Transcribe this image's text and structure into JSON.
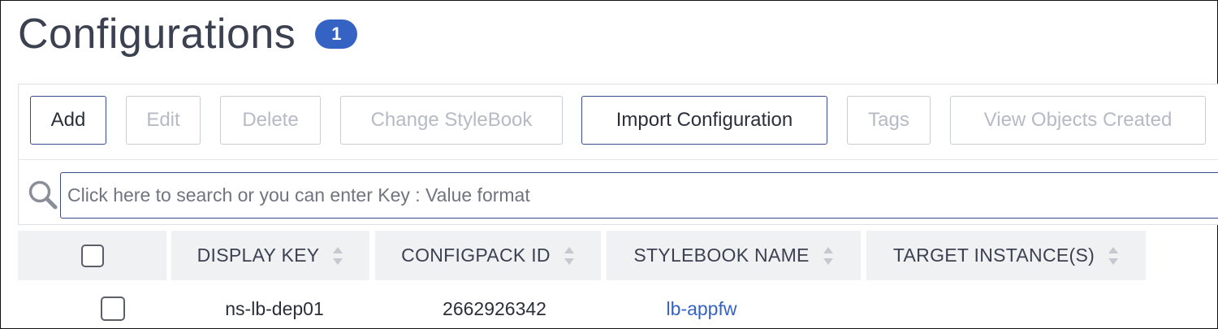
{
  "header": {
    "title": "Configurations",
    "count": "1"
  },
  "toolbar": {
    "buttons": [
      {
        "label": "Add",
        "enabled": true
      },
      {
        "label": "Edit",
        "enabled": false
      },
      {
        "label": "Delete",
        "enabled": false
      },
      {
        "label": "Change StyleBook",
        "enabled": false
      },
      {
        "label": "Import Configuration",
        "enabled": true
      },
      {
        "label": "Tags",
        "enabled": false
      },
      {
        "label": "View Objects Created",
        "enabled": false
      }
    ]
  },
  "search": {
    "placeholder": "Click here to search or you can enter Key : Value format",
    "value": ""
  },
  "table": {
    "columns": [
      "DISPLAY KEY",
      "CONFIGPACK ID",
      "STYLEBOOK NAME",
      "TARGET INSTANCE(S)"
    ],
    "rows": [
      {
        "display_key": "ns-lb-dep01",
        "configpack_id": "2662926342",
        "stylebook_name": "lb-appfw",
        "target_instances": ""
      }
    ]
  },
  "colors": {
    "accent": "#3563c4",
    "active_border": "#3a4a8a",
    "disabled_text": "#b6bac4",
    "header_bg": "#f0f1f3"
  },
  "icons": {
    "search": "search-icon",
    "sort": "sort-icon",
    "checkbox": "checkbox"
  }
}
